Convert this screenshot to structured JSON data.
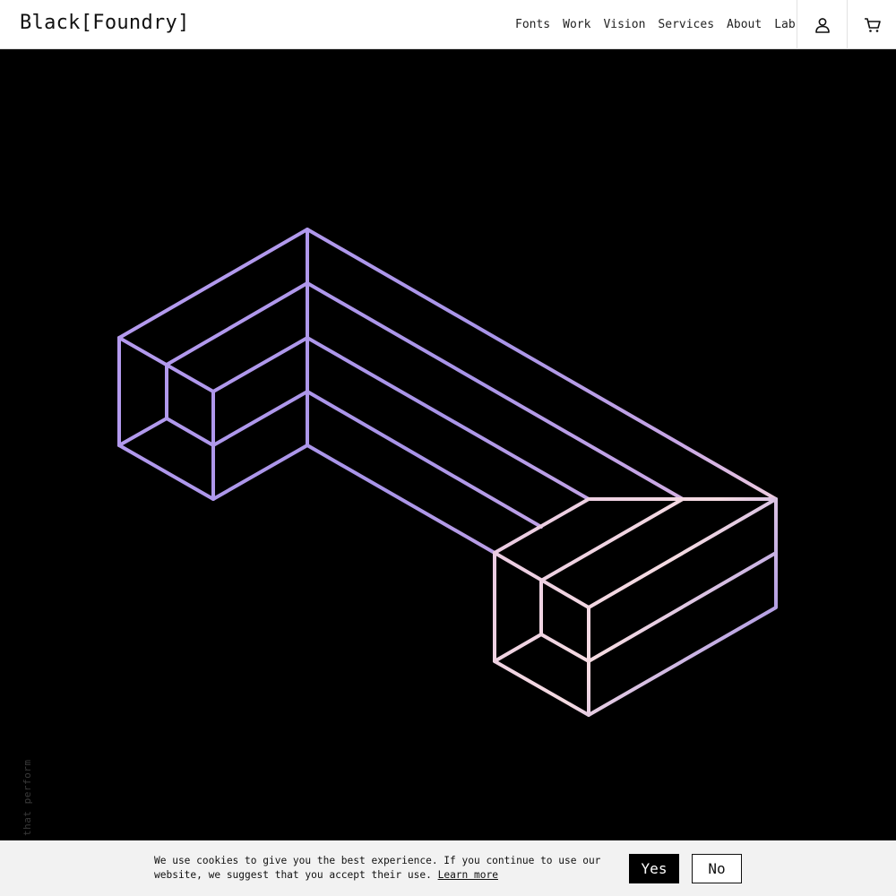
{
  "header": {
    "logo": "Black[Foundry]",
    "nav": [
      "Fonts",
      "Work",
      "Vision",
      "Services",
      "About",
      "Lab"
    ],
    "account_icon": "user-icon",
    "cart_icon": "cart-icon"
  },
  "hero": {
    "tagline": "that perform",
    "art_colors": [
      "#b59aee",
      "#8f7ae4",
      "#e4bcd8",
      "#f2d6e0"
    ]
  },
  "cookie": {
    "text": "We use cookies to give you the best experience. If you continue to use our website, we suggest that you accept their use.",
    "link": "Learn more",
    "yes": "Yes",
    "no": "No"
  }
}
